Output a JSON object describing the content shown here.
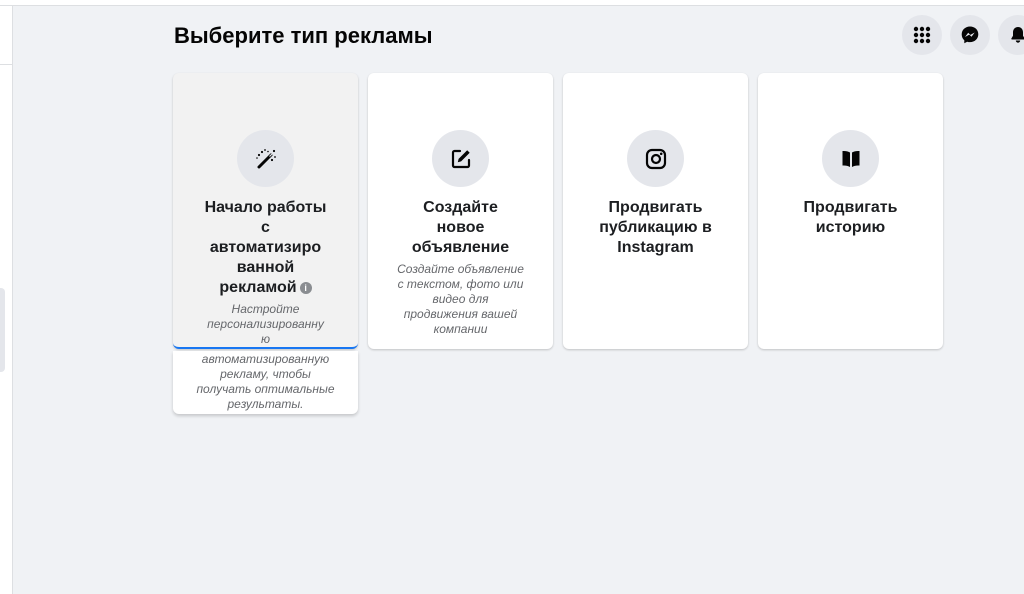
{
  "page": {
    "title": "Выберите тип рекламы"
  },
  "top_actions": [
    {
      "icon": "menu-grid-icon"
    },
    {
      "icon": "messenger-icon"
    },
    {
      "icon": "bell-icon"
    }
  ],
  "colors": {
    "accent": "#1877f2",
    "background": "#f0f2f5",
    "icon_circle": "#e4e6eb",
    "muted_text": "#65676b"
  },
  "cards": [
    {
      "icon": "magic-wand-icon",
      "title": "Начало работы с автоматизиро ванной рекламой",
      "title_lines": [
        "Начало работы",
        "с",
        "автоматизиро",
        "ванной",
        "рекламой"
      ],
      "info_icon": "info-icon",
      "description_lines": [
        "Настройте",
        "персонализированну",
        "ю",
        "автоматизированную",
        "рекламу, чтобы",
        "получать оптимальные",
        "результаты."
      ]
    },
    {
      "icon": "edit-icon",
      "title": "Создайте новое объявление",
      "title_lines": [
        "Создайте",
        "новое",
        "объявление"
      ],
      "description_lines": [
        "Создайте объявление",
        "с текстом, фото или",
        "видео для",
        "продвижения вашей",
        "компании"
      ]
    },
    {
      "icon": "instagram-icon",
      "title": "Продвигать публикацию в Instagram",
      "title_lines": [
        "Продвигать",
        "публикацию в",
        "Instagram"
      ]
    },
    {
      "icon": "book-icon",
      "title": "Продвигать историю",
      "title_lines": [
        "Продвигать",
        "историю"
      ]
    }
  ]
}
